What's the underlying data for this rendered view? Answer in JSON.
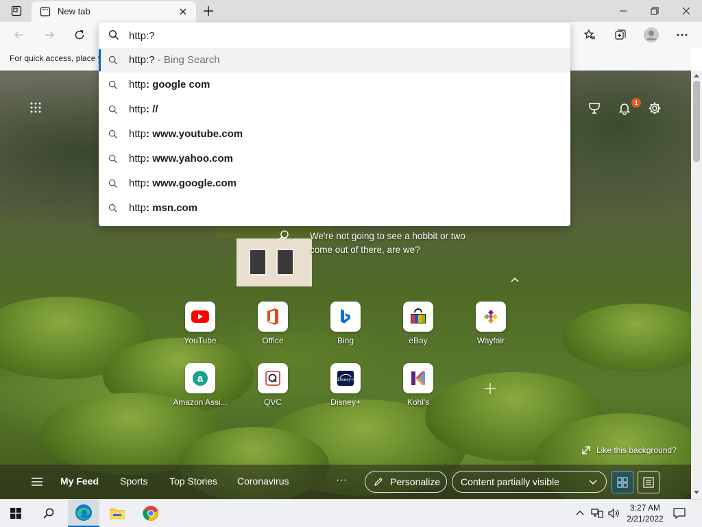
{
  "browser": {
    "tab_title": "New tab",
    "favorites_hint": "For quick access, place y",
    "address_value": "http:?"
  },
  "suggestions": [
    {
      "prefix": "http:?",
      "suffix": " - Bing Search",
      "type": "search-engine",
      "selected": true
    },
    {
      "prefix": "http",
      "suffix": ": google com",
      "type": "query"
    },
    {
      "prefix": "http",
      "suffix": ": //",
      "type": "query"
    },
    {
      "prefix": "http",
      "suffix": ": www.youtube.com",
      "type": "query"
    },
    {
      "prefix": "http",
      "suffix": ": www.yahoo.com",
      "type": "query"
    },
    {
      "prefix": "http",
      "suffix": ": www.google.com",
      "type": "query"
    },
    {
      "prefix": "http",
      "suffix": ": msn.com",
      "type": "query"
    }
  ],
  "ntp": {
    "notification_count": "1",
    "quote_line1": "We're not going to see a hobbit or two",
    "quote_line2": "come out of there, are we?",
    "like_background": "Like this background?"
  },
  "tiles": [
    {
      "label": "YouTube",
      "icon": "youtube-icon",
      "color": "#ff0000"
    },
    {
      "label": "Office",
      "icon": "office-icon",
      "color": "#e64a19"
    },
    {
      "label": "Bing",
      "icon": "bing-icon",
      "color": "#0a74d6"
    },
    {
      "label": "eBay",
      "icon": "ebay-icon",
      "color": "#1b1b1b"
    },
    {
      "label": "Wayfair",
      "icon": "wayfair-icon",
      "color": "#7f187f"
    },
    {
      "label": "Amazon Assi...",
      "icon": "amazon-assistant-icon",
      "color": "#1aa38c"
    },
    {
      "label": "QVC",
      "icon": "qvc-icon",
      "color": "#d12027"
    },
    {
      "label": "Disney+",
      "icon": "disney-plus-icon",
      "color": "#0c1a4b"
    },
    {
      "label": "Kohl's",
      "icon": "kohls-icon",
      "color": "#a0224f"
    }
  ],
  "feed": {
    "my_feed": "My Feed",
    "sports": "Sports",
    "top_stories": "Top Stories",
    "coronavirus": "Coronavirus",
    "more": "···",
    "personalize": "Personalize",
    "content_visibility": "Content partially visible"
  },
  "taskbar": {
    "time": "3:27 AM",
    "date": "2/21/2022"
  },
  "colors": {
    "accent": "#0067c0",
    "notification_badge": "#e05a1c"
  }
}
